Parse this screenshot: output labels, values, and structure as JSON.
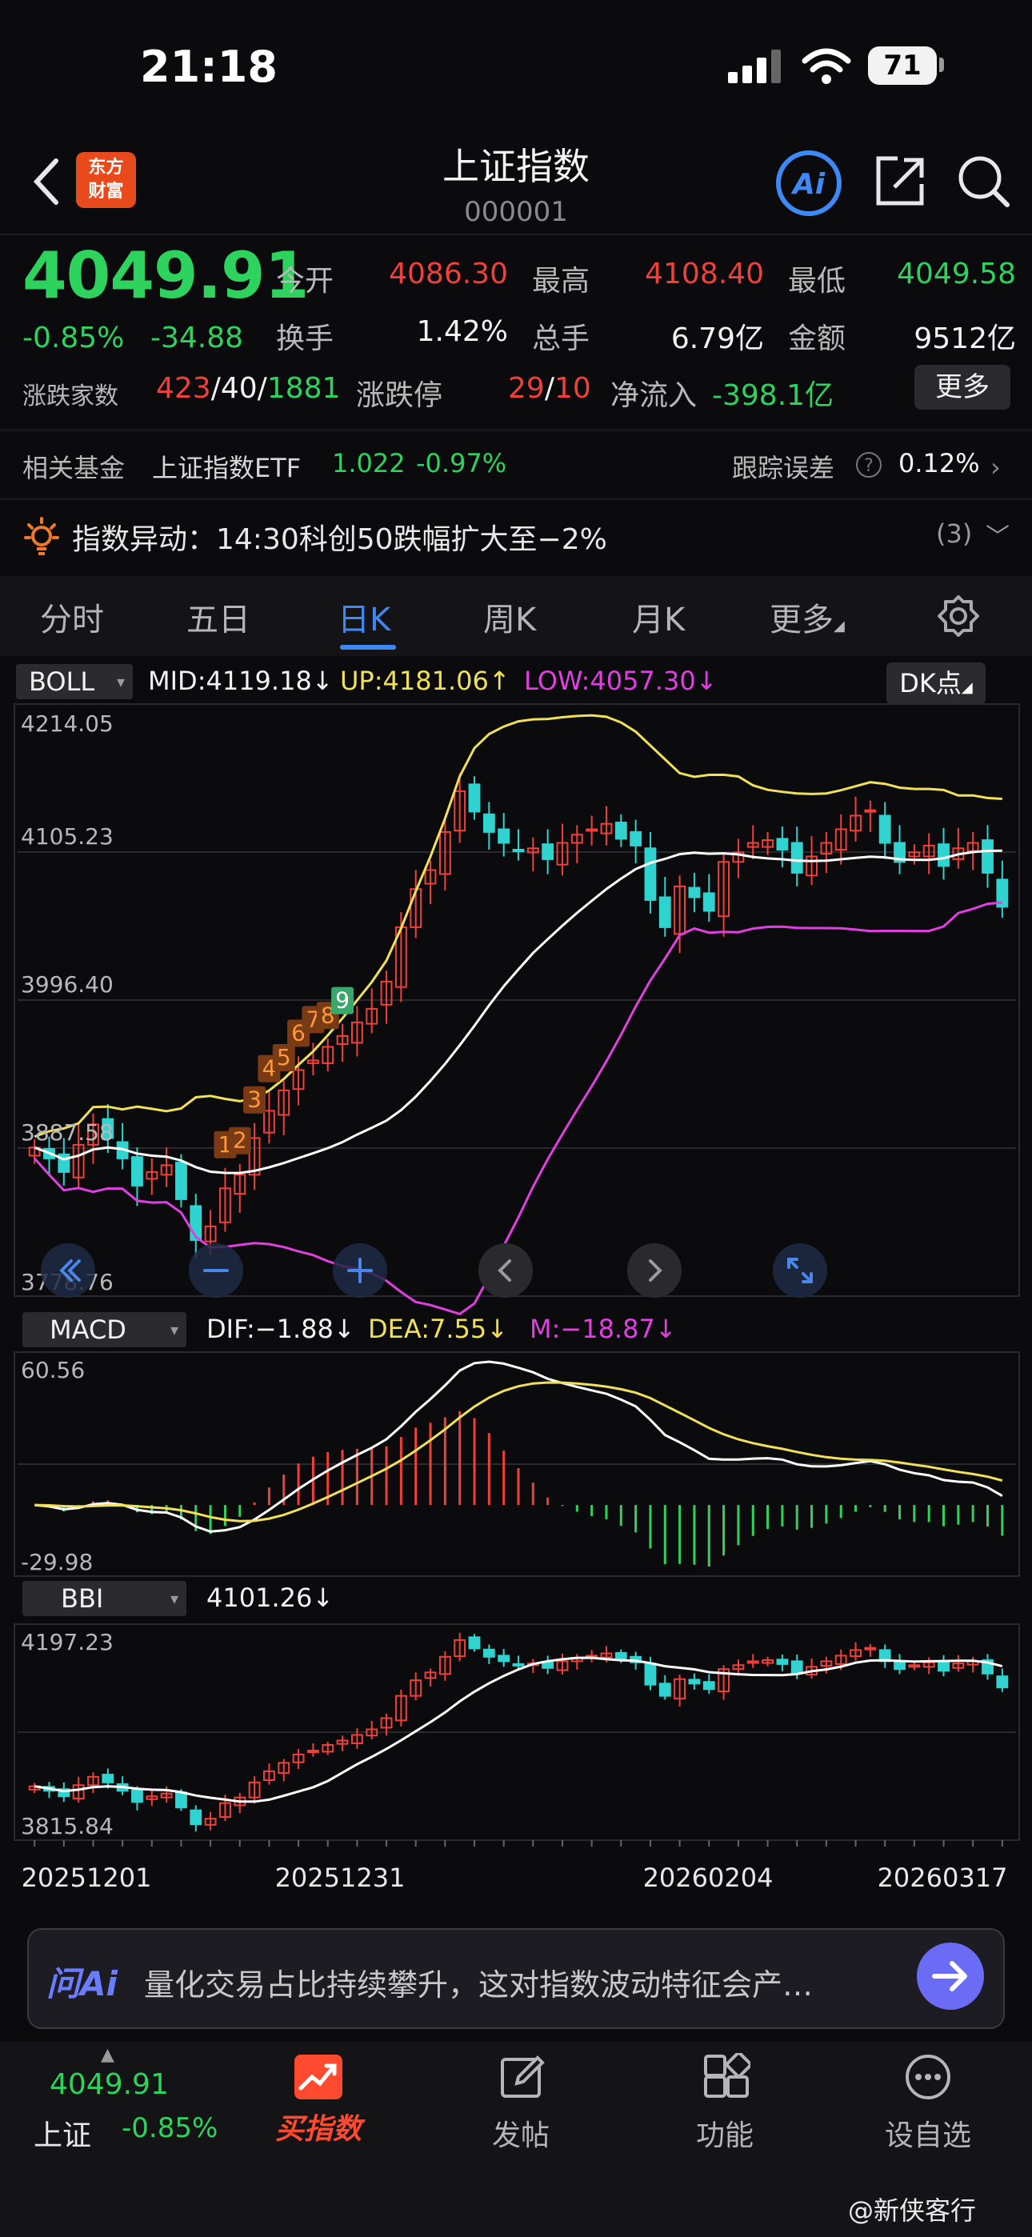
{
  "status": {
    "time": "21:18",
    "battery": "71"
  },
  "header": {
    "title": "上证指数",
    "code": "000001",
    "logo_line1": "东方",
    "logo_line2": "财富",
    "ai_label": "Ai"
  },
  "quote": {
    "price": "4049.91",
    "change_pct": "-0.85%",
    "change_abs": "-34.88",
    "open_label": "今开",
    "open": "4086.30",
    "high_label": "最高",
    "high": "4108.40",
    "low_label": "最低",
    "low": "4049.58",
    "turnover_label": "换手",
    "turnover": "1.42%",
    "volume_label": "总手",
    "volume": "6.79亿",
    "amount_label": "金额",
    "amount": "9512亿",
    "breadth_label": "涨跌家数",
    "breadth_up": "423",
    "breadth_flat": "40",
    "breadth_down": "1881",
    "slash": "/",
    "limit_label": "涨跌停",
    "limit_up": "29",
    "limit_down": "10",
    "netflow_label": "净流入",
    "netflow": "-398.1亿",
    "more_label": "更多"
  },
  "fund": {
    "label": "相关基金",
    "name": "上证指数ETF",
    "price": "1.022",
    "change": "-0.97%",
    "track_label": "跟踪误差",
    "track_q": "?",
    "track_value": "0.12%"
  },
  "alert": {
    "text": "指数异动：14:30科创50跌幅扩大至−2%",
    "count": "(3)"
  },
  "tabs": [
    "分时",
    "五日",
    "日K",
    "周K",
    "月K",
    "更多"
  ],
  "active_tab": "日K",
  "indicators": {
    "boll": {
      "name": "BOLL",
      "mid": "MID:4119.18↓",
      "up": "UP:4181.06↑",
      "low": "LOW:4057.30↓"
    },
    "dk_label": "DK点",
    "macd": {
      "name": "MACD",
      "dif": "DIF:−1.88↓",
      "dea": "DEA:7.55↓",
      "m": "M:−18.87↓"
    },
    "bbi": {
      "name": "BBI",
      "value": "4101.26↓"
    }
  },
  "chart_data": {
    "type": "candlestick",
    "main_axis_labels": [
      "4214.05",
      "4105.23",
      "3996.40",
      "3887.58",
      "3778.76"
    ],
    "main_ylim": [
      3778.76,
      4214.05
    ],
    "macd_axis_labels": [
      "60.56",
      "-29.98"
    ],
    "bbi_axis_labels": [
      "4197.23",
      "3815.84"
    ],
    "dates": [
      "20251201",
      "20251231",
      "20260204",
      "20260317"
    ],
    "sequence_labels": [
      "1",
      "2",
      "3",
      "4",
      "5",
      "6",
      "7",
      "8",
      "9"
    ],
    "closes": [
      3888,
      3880,
      3870,
      3890,
      3905,
      3895,
      3880,
      3860,
      3870,
      3875,
      3850,
      3820,
      3830,
      3858,
      3868,
      3895,
      3915,
      3930,
      3945,
      3952,
      3962,
      3970,
      3980,
      3990,
      4010,
      4050,
      4078,
      4092,
      4120,
      4150,
      4135,
      4120,
      4112,
      4106,
      4108,
      4100,
      4112,
      4118,
      4122,
      4126,
      4115,
      4110,
      4070,
      4050,
      4080,
      4072,
      4062,
      4098,
      4105,
      4112,
      4114,
      4107,
      4090,
      4102,
      4112,
      4122,
      4132,
      4136,
      4112,
      4098,
      4105,
      4110,
      4095,
      4108,
      4112,
      4090,
      4065
    ],
    "colors": {
      "up": "#f0403a",
      "down": "#2fd3d0",
      "mid": "#ffffff",
      "upper": "#f0e05a",
      "lower": "#e040e0",
      "accent": "#3d8af7"
    }
  },
  "chart_controls": [
    "rewind-icon",
    "zoom-out-icon",
    "zoom-in-icon",
    "pan-left-icon",
    "pan-right-icon",
    "fullscreen-icon"
  ],
  "ai_bar": {
    "logo": "问Ai",
    "text": "量化交易占比持续攀升，这对指数波动特征会产…"
  },
  "bottom_nav": {
    "price": "4049.91",
    "index_name": "上证",
    "index_change": "-0.85%",
    "buy_label": "买指数",
    "post_label": "发帖",
    "func_label": "功能",
    "watch_label": "设自选"
  },
  "watermark": "@新侠客行"
}
